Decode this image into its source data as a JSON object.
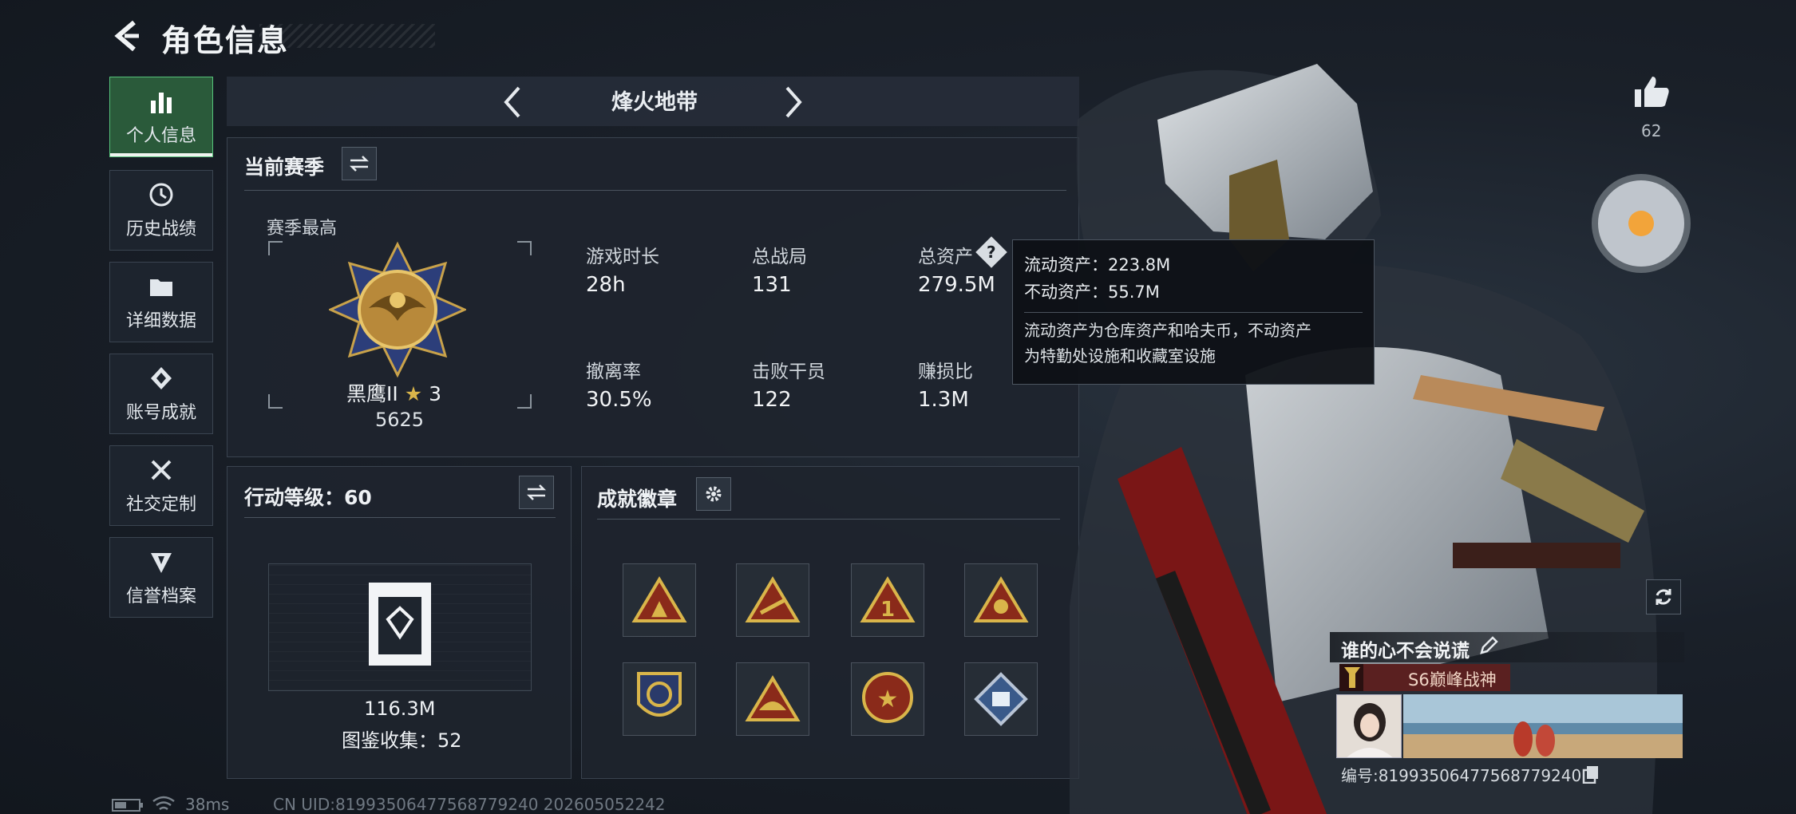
{
  "header": {
    "title": "角色信息"
  },
  "nav": [
    {
      "label": "个人信息",
      "icon": "bar-chart-icon",
      "active": true
    },
    {
      "label": "历史战绩",
      "icon": "history-icon"
    },
    {
      "label": "详细数据",
      "icon": "folder-icon"
    },
    {
      "label": "账号成就",
      "icon": "achievement-icon"
    },
    {
      "label": "社交定制",
      "icon": "tools-icon"
    },
    {
      "label": "信誉档案",
      "icon": "shield-icon"
    }
  ],
  "mode": {
    "title": "烽火地带"
  },
  "season": {
    "title": "当前赛季",
    "best_label": "赛季最高",
    "rank_name": "黑鹰II",
    "rank_stars": "3",
    "rank_score": "5625",
    "stats": [
      {
        "label": "游戏时长",
        "value": "28h"
      },
      {
        "label": "总战局",
        "value": "131"
      },
      {
        "label": "总资产",
        "value": "279.5M"
      },
      {
        "label": "撤离率",
        "value": "30.5%"
      },
      {
        "label": "击败干员",
        "value": "122"
      },
      {
        "label": "赚损比",
        "value": "1.3M"
      }
    ]
  },
  "tooltip": {
    "liquid": "流动资产：223.8M",
    "fixed": "不动资产：55.7M",
    "desc_line1": "流动资产为仓库资产和哈夫币，不动资产",
    "desc_line2": "为特勤处设施和收藏室设施"
  },
  "level": {
    "title": "行动等级：60",
    "value": "116.3M",
    "collection": "图鉴收集：52"
  },
  "badges": {
    "title": "成就徽章",
    "items": [
      "badge-1",
      "badge-2",
      "badge-3",
      "badge-4",
      "badge-5",
      "badge-6",
      "badge-7",
      "badge-8"
    ]
  },
  "likes": {
    "count": "62"
  },
  "profile": {
    "name": "谁的心不会说谎",
    "rank_title": "S6巅峰战神",
    "uid": "编号:8199350647756877924​0"
  },
  "footer": {
    "ping": "38ms",
    "uid": "CN UID:81993506477568779240  202605052242"
  },
  "colors": {
    "accent_green": "#56c27a",
    "tag_red": "#5a2020",
    "gold": "#c9a24a"
  }
}
